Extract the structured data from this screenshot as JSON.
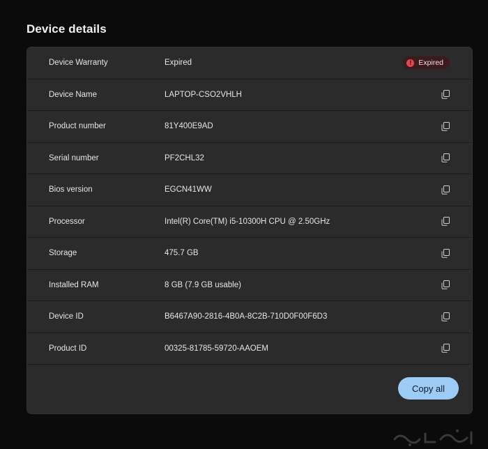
{
  "page": {
    "title": "Device details"
  },
  "rows": [
    {
      "label": "Device Warranty",
      "value": "Expired",
      "badge": "Expired"
    },
    {
      "label": "Device Name",
      "value": "LAPTOP-CSO2VHLH"
    },
    {
      "label": "Product number",
      "value": "81Y400E9AD"
    },
    {
      "label": "Serial number",
      "value": "PF2CHL32"
    },
    {
      "label": "Bios version",
      "value": "EGCN41WW"
    },
    {
      "label": "Processor",
      "value": "Intel(R) Core(TM) i5-10300H CPU @ 2.50GHz"
    },
    {
      "label": "Storage",
      "value": "475.7 GB"
    },
    {
      "label": "Installed RAM",
      "value": "8 GB (7.9 GB usable)"
    },
    {
      "label": "Device ID",
      "value": "B6467A90-2816-4B0A-8C2B-710D0F00F6D3"
    },
    {
      "label": "Product ID",
      "value": "00325-81785-59720-AAOEM"
    }
  ],
  "actions": {
    "copy_all_label": "Copy all"
  },
  "icons": {
    "copy": "copy-icon",
    "badge": "error-icon"
  },
  "colors": {
    "accent": "#9ccbf6",
    "badge_bg": "#3d1a1d",
    "badge_icon": "#e0494f",
    "card_bg": "#2b2b2b"
  }
}
